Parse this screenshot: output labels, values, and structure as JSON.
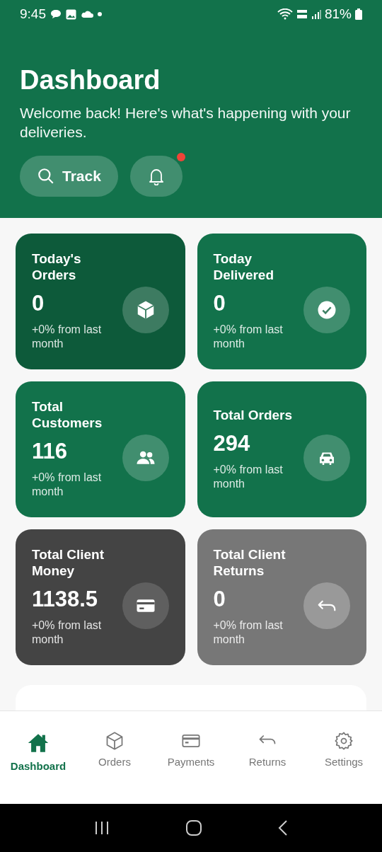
{
  "status_bar": {
    "time": "9:45",
    "battery": "81%"
  },
  "header": {
    "title": "Dashboard",
    "subtitle": "Welcome back! Here's what's happening with your deliveries.",
    "track_button": "Track",
    "notification_badge": true
  },
  "stats": [
    {
      "title": "Today's Orders",
      "value": "0",
      "change": "+0% from last month",
      "kind": "box",
      "color": "#0d5a3a"
    },
    {
      "title": "Today Delivered",
      "value": "0",
      "change": "+0% from last month",
      "kind": "check",
      "color": "#12724b"
    },
    {
      "title": "Total Customers",
      "value": "116",
      "change": "+0% from last month",
      "kind": "people",
      "color": "#12724b"
    },
    {
      "title": "Total Orders",
      "value": "294",
      "change": "+0% from last month",
      "kind": "car",
      "color": "#12724b"
    },
    {
      "title": "Total Client Money",
      "value": "1138.5",
      "change": "+0% from last month",
      "kind": "card",
      "color": "#444444"
    },
    {
      "title": "Total Client Returns",
      "value": "0",
      "change": "+0% from last month",
      "kind": "return",
      "color": "#777777"
    }
  ],
  "bottom_nav": [
    {
      "label": "Dashboard",
      "kind": "home",
      "selected": true
    },
    {
      "label": "Orders",
      "kind": "box",
      "selected": false
    },
    {
      "label": "Payments",
      "kind": "card",
      "selected": false
    },
    {
      "label": "Returns",
      "kind": "return",
      "selected": false
    },
    {
      "label": "Settings",
      "kind": "gear",
      "selected": false
    }
  ]
}
